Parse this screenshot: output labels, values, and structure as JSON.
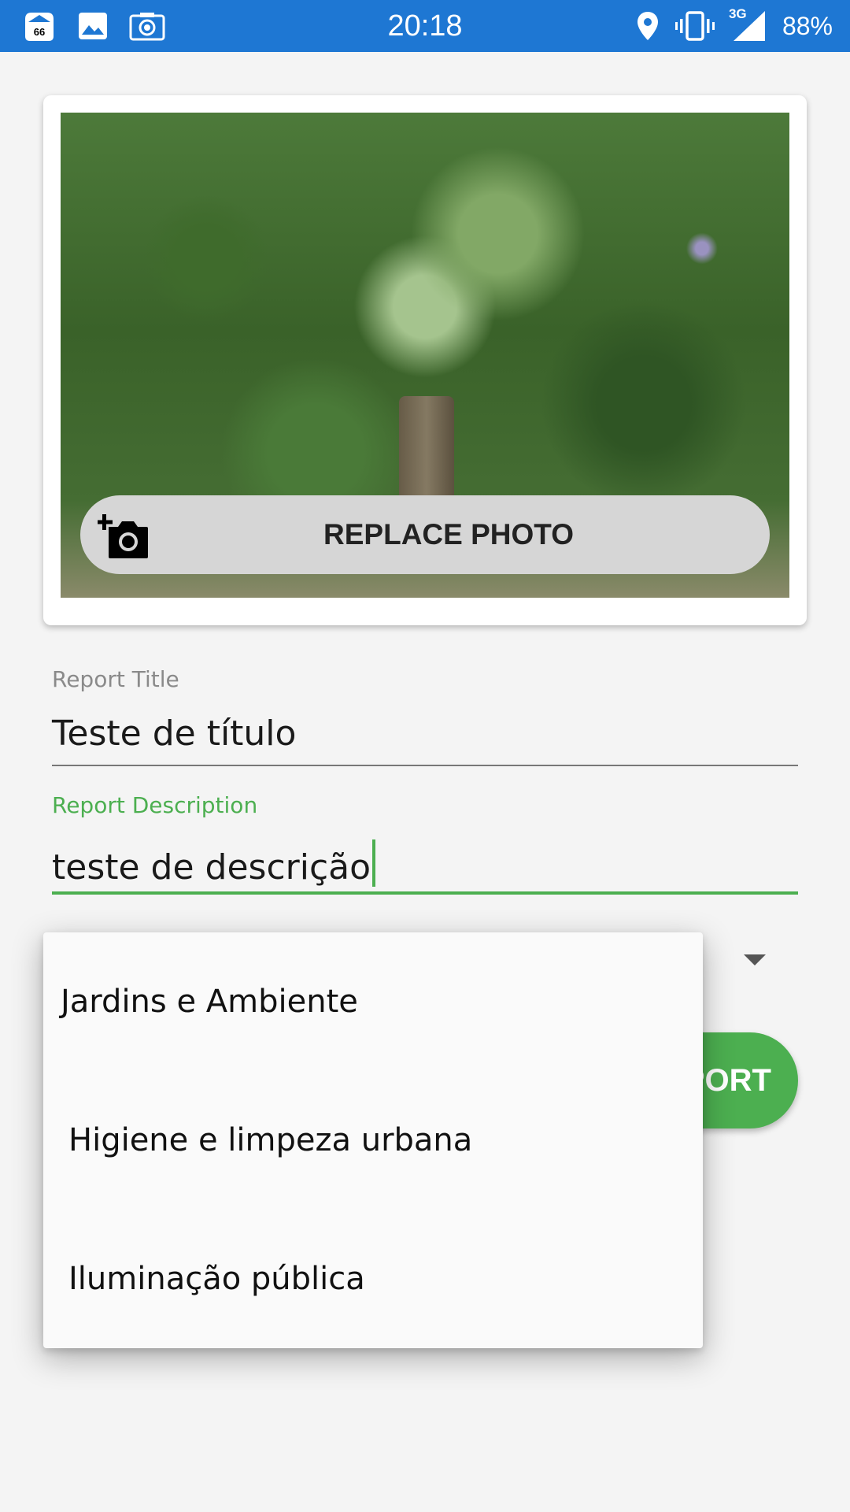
{
  "status_bar": {
    "time": "20:18",
    "battery": "88%",
    "network": "3G",
    "notification_badge": "66",
    "left_icons": [
      "notification-66-icon",
      "image-icon",
      "camera-icon"
    ],
    "right_icons": [
      "location-icon",
      "vibrate-icon",
      "signal-icon"
    ],
    "background": "#1e77d3"
  },
  "photo_card": {
    "replace_button_label": "REPLACE PHOTO",
    "replace_icon": "add-photo-icon"
  },
  "form": {
    "title_label": "Report Title",
    "title_value": "Teste de título",
    "description_label": "Report Description",
    "description_value": "teste de descrição",
    "accent_color": "#4caf50"
  },
  "report_button": {
    "label": "PORT"
  },
  "category_dropdown": {
    "options": [
      "Jardins e Ambiente",
      "Higiene e limpeza urbana",
      "Iluminação pública"
    ]
  }
}
